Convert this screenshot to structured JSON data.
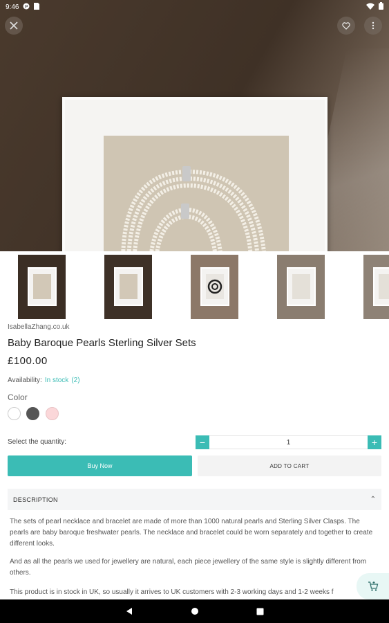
{
  "status_bar": {
    "time": "9:46"
  },
  "colors": {
    "accent": "#3bbcb5",
    "hero_bg": "#4b3a2d",
    "swatches": [
      "#ffffff",
      "#555555",
      "#fbd7d9"
    ]
  },
  "icons": {
    "close": "close-icon",
    "favorite": "heart-icon",
    "more": "more-vert-icon",
    "cart": "cart-icon",
    "back": "triangle-back-icon",
    "home": "circle-home-icon",
    "recents": "square-recents-icon"
  },
  "product": {
    "seller": "IsabellaZhang.co.uk",
    "title": "Baby Baroque Pearls Sterling Silver Sets",
    "price": "£100.00",
    "availability_label": "Availability:",
    "availability_status": "In stock",
    "availability_count": "(2)",
    "color_label": "Color",
    "quantity_label": "Select the quantity:",
    "quantity_value": "1",
    "minus": "−",
    "plus": "+",
    "buy_now": "Buy Now",
    "add_to_cart": "ADD TO CART"
  },
  "description": {
    "title": "DESCRIPTION",
    "chevron": "⌃",
    "paragraphs": [
      "The sets of pearl necklace and bracelet are made of more than 1000 natural pearls and Sterling Silver Clasps. The pearls are baby baroque freshwater pearls. The necklace and bracelet could be worn separately and together to create different looks.",
      "And as all the pearls we used for jewellery are natural, each piece jewellery of the same style is slightly different from others.",
      "This product is in stock in UK, so usually it arrives to UK customers with 2-3 working days and 1-2 weeks f"
    ]
  }
}
